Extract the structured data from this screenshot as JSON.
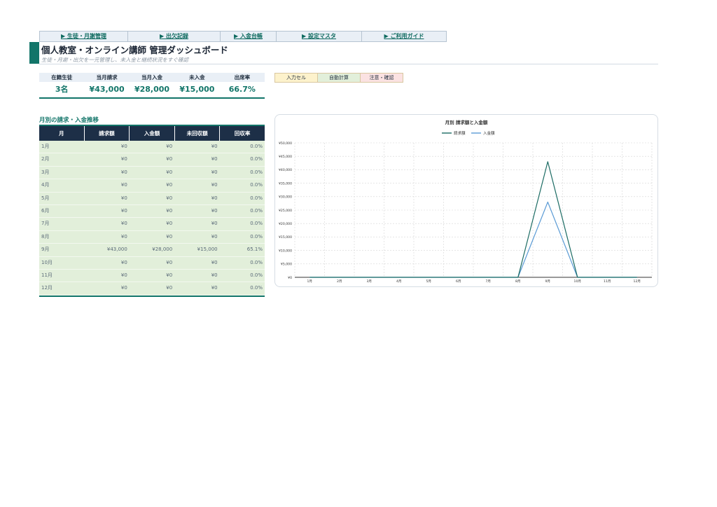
{
  "nav": [
    "▶ 生徒・月謝管理",
    "▶ 出欠記録",
    "▶ 入金台帳",
    "▶ 設定マスタ",
    "▶ ご利用ガイド"
  ],
  "header": {
    "title": "個人教室・オンライン講師 管理ダッシュボード",
    "subtitle": "生徒・月謝・出欠を一元管理し、未入金と継続状況をすぐ確認"
  },
  "kpis": [
    {
      "label": "在籍生徒",
      "value": "3名"
    },
    {
      "label": "当月請求",
      "value": "¥43,000"
    },
    {
      "label": "当月入金",
      "value": "¥28,000"
    },
    {
      "label": "未入金",
      "value": "¥15,000"
    },
    {
      "label": "出席率",
      "value": "66.7%"
    }
  ],
  "cell_legend": [
    {
      "label": "入力セル",
      "color": "#fdf2cc"
    },
    {
      "label": "自動計算",
      "color": "#e2efda"
    },
    {
      "label": "注意・確認",
      "color": "#fbe2e2"
    }
  ],
  "table": {
    "title": "月別の請求・入金推移",
    "headers": [
      "月",
      "請求額",
      "入金額",
      "未回収額",
      "回収率"
    ],
    "rows": [
      [
        "1月",
        "¥0",
        "¥0",
        "¥0",
        "0.0%"
      ],
      [
        "2月",
        "¥0",
        "¥0",
        "¥0",
        "0.0%"
      ],
      [
        "3月",
        "¥0",
        "¥0",
        "¥0",
        "0.0%"
      ],
      [
        "4月",
        "¥0",
        "¥0",
        "¥0",
        "0.0%"
      ],
      [
        "5月",
        "¥0",
        "¥0",
        "¥0",
        "0.0%"
      ],
      [
        "6月",
        "¥0",
        "¥0",
        "¥0",
        "0.0%"
      ],
      [
        "7月",
        "¥0",
        "¥0",
        "¥0",
        "0.0%"
      ],
      [
        "8月",
        "¥0",
        "¥0",
        "¥0",
        "0.0%"
      ],
      [
        "9月",
        "¥43,000",
        "¥28,000",
        "¥15,000",
        "65.1%"
      ],
      [
        "10月",
        "¥0",
        "¥0",
        "¥0",
        "0.0%"
      ],
      [
        "11月",
        "¥0",
        "¥0",
        "¥0",
        "0.0%"
      ],
      [
        "12月",
        "¥0",
        "¥0",
        "¥0",
        "0.0%"
      ]
    ]
  },
  "chart_data": {
    "type": "line",
    "title": "月別 請求額と入金額",
    "categories": [
      "1月",
      "2月",
      "3月",
      "4月",
      "5月",
      "6月",
      "7月",
      "8月",
      "9月",
      "10月",
      "11月",
      "12月"
    ],
    "series": [
      {
        "name": "請求額",
        "values": [
          0,
          0,
          0,
          0,
          0,
          0,
          0,
          0,
          43000,
          0,
          0,
          0
        ],
        "color": "#1b6b63"
      },
      {
        "name": "入金額",
        "values": [
          0,
          0,
          0,
          0,
          0,
          0,
          0,
          0,
          28000,
          0,
          0,
          0
        ],
        "color": "#5b9bd5"
      }
    ],
    "yticks": [
      "¥0",
      "¥5,000",
      "¥10,000",
      "¥15,000",
      "¥20,000",
      "¥25,000",
      "¥30,000",
      "¥35,000",
      "¥40,000",
      "¥45,000",
      "¥50,000"
    ],
    "ylim": [
      0,
      50000
    ],
    "grid": true,
    "legend": "top-center"
  }
}
